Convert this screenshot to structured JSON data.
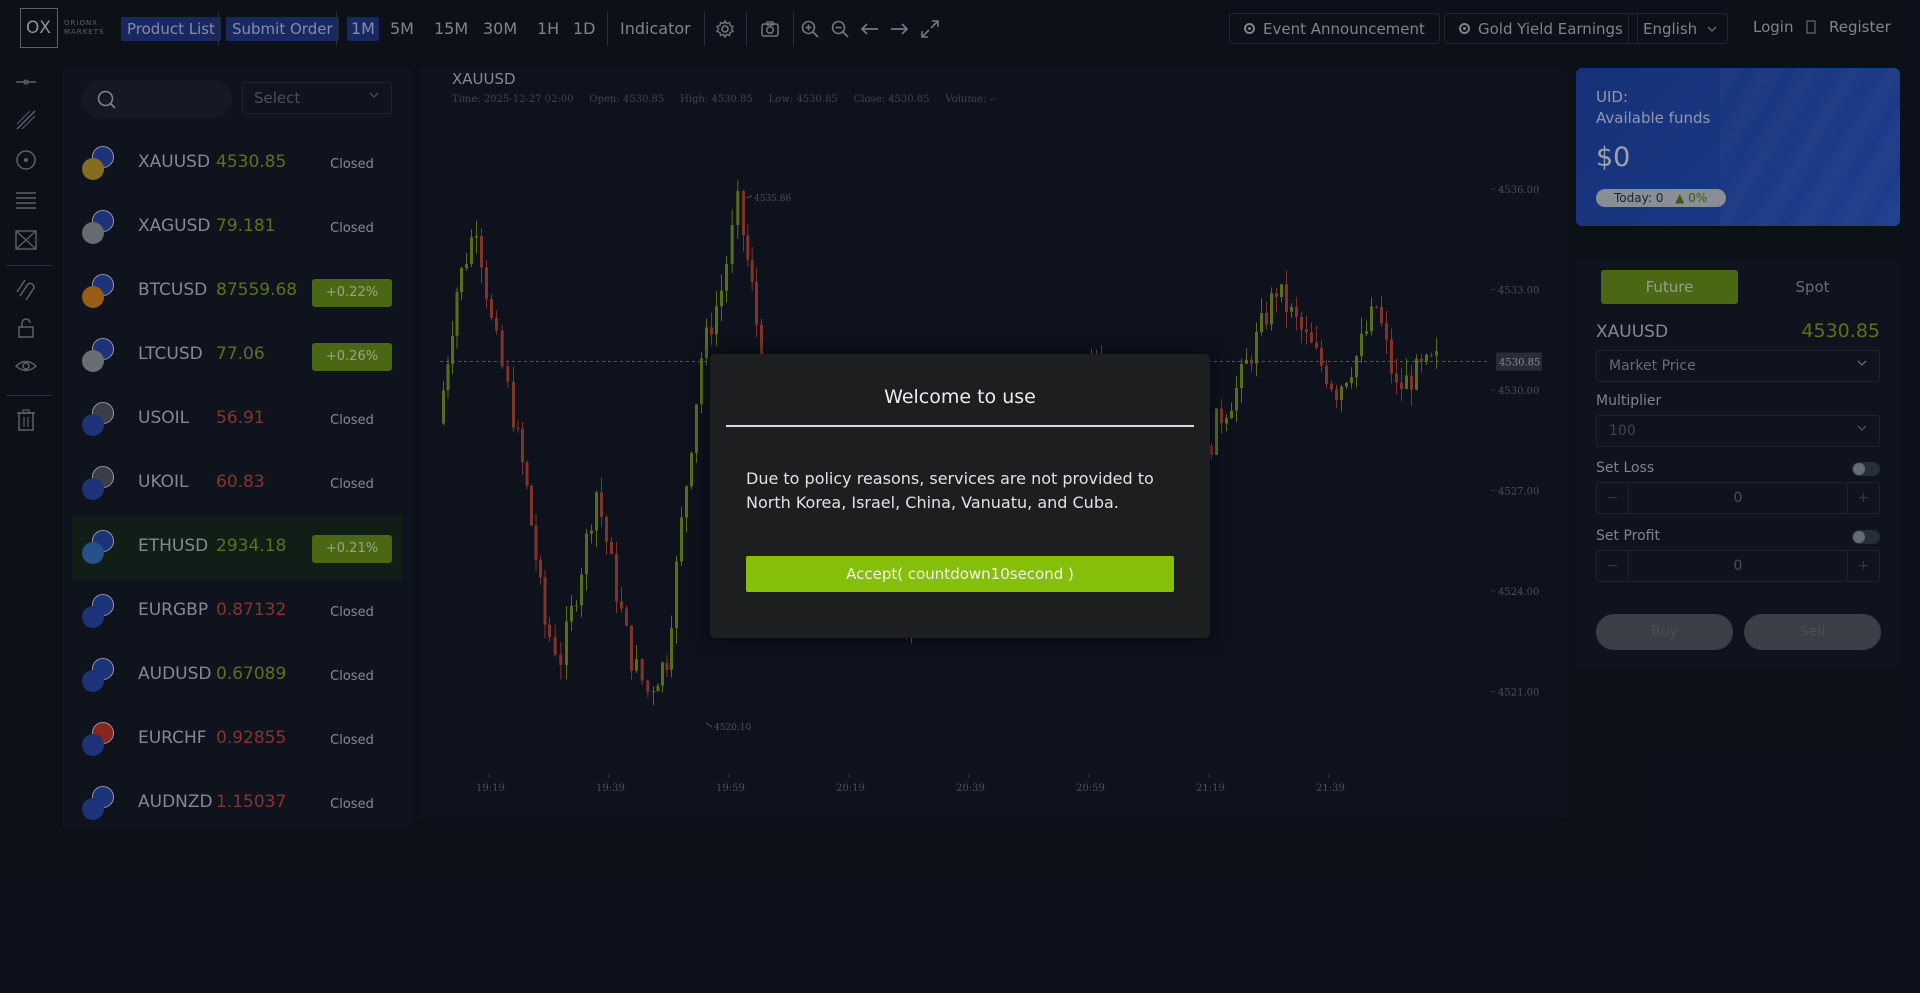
{
  "topbar": {
    "logo_text": "OX",
    "logo_sub_1": "ORIONX",
    "logo_sub_2": "MARKETS",
    "product_list": "Product List",
    "submit_order": "Submit Order",
    "timeframes": [
      "1M",
      "5M",
      "15M",
      "30M",
      "1H",
      "1D"
    ],
    "active_timeframe": "1M",
    "indicator": "Indicator",
    "event_announcement": "Event Announcement",
    "gold_yield": "Gold Yield Earnings",
    "language": "English",
    "login": "Login",
    "register": "Register"
  },
  "product_list": {
    "select_placeholder": "Select",
    "items": [
      {
        "symbol": "XAUUSD",
        "price": "4530.85",
        "trend": "up",
        "status": "Closed",
        "status_kind": "closed"
      },
      {
        "symbol": "XAGUSD",
        "price": "79.181",
        "trend": "up",
        "status": "Closed",
        "status_kind": "closed"
      },
      {
        "symbol": "BTCUSD",
        "price": "87559.68",
        "trend": "up",
        "status": "+0.22%",
        "status_kind": "change"
      },
      {
        "symbol": "LTCUSD",
        "price": "77.06",
        "trend": "up",
        "status": "+0.26%",
        "status_kind": "change"
      },
      {
        "symbol": "USOIL",
        "price": "56.91",
        "trend": "down",
        "status": "Closed",
        "status_kind": "closed"
      },
      {
        "symbol": "UKOIL",
        "price": "60.83",
        "trend": "down",
        "status": "Closed",
        "status_kind": "closed"
      },
      {
        "symbol": "ETHUSD",
        "price": "2934.18",
        "trend": "up",
        "status": "+0.21%",
        "status_kind": "change"
      },
      {
        "symbol": "EURGBP",
        "price": "0.87132",
        "trend": "down",
        "status": "Closed",
        "status_kind": "closed"
      },
      {
        "symbol": "AUDUSD",
        "price": "0.67089",
        "trend": "up",
        "status": "Closed",
        "status_kind": "closed"
      },
      {
        "symbol": "EURCHF",
        "price": "0.92855",
        "trend": "down",
        "status": "Closed",
        "status_kind": "closed"
      },
      {
        "symbol": "AUDNZD",
        "price": "1.15037",
        "trend": "down",
        "status": "Closed",
        "status_kind": "closed"
      }
    ]
  },
  "chart": {
    "symbol": "XAUUSD",
    "info": "Time: 2025-12-27 02:00     Open: 4530.85     High: 4530.85     Low: 4530.85     Close: 4530.85     Volume: --",
    "y_ticks": [
      "4536.00",
      "4533.00",
      "4530.00",
      "4527.00",
      "4524.00",
      "4521.00"
    ],
    "x_ticks": [
      "19:19",
      "19:39",
      "19:59",
      "20:19",
      "20:39",
      "20:59",
      "21:19",
      "21:39"
    ],
    "current_price": "4530.85",
    "high_label": "4535.86",
    "low_label": "4520.10",
    "colors": {
      "up": "#86a41e",
      "down": "#c24a3a"
    }
  },
  "account": {
    "uid_label": "UID:",
    "funds_label": "Available funds",
    "balance": "$0",
    "today_label": "Today: 0",
    "today_pct": "▲ 0%"
  },
  "order": {
    "tab_future": "Future",
    "tab_spot": "Spot",
    "symbol": "XAUUSD",
    "price": "4530.85",
    "order_type": "Market Price",
    "multiplier_label": "Multiplier",
    "multiplier_value": "100",
    "set_loss_label": "Set Loss",
    "set_loss_value": "0",
    "set_profit_label": "Set Profit",
    "set_profit_value": "0",
    "buy": "Buy",
    "sell": "Sell",
    "minus": "−",
    "plus": "+"
  },
  "modal": {
    "title": "Welcome to use",
    "message": "Due to policy reasons, services are not provided to North Korea, Israel, China, Vanuatu, and Cuba.",
    "accept": "Accept( countdown10second )"
  },
  "colors": {
    "accent_green": "#86bf0a",
    "nav_blue": "#243a8a",
    "background": "#0f1420"
  }
}
